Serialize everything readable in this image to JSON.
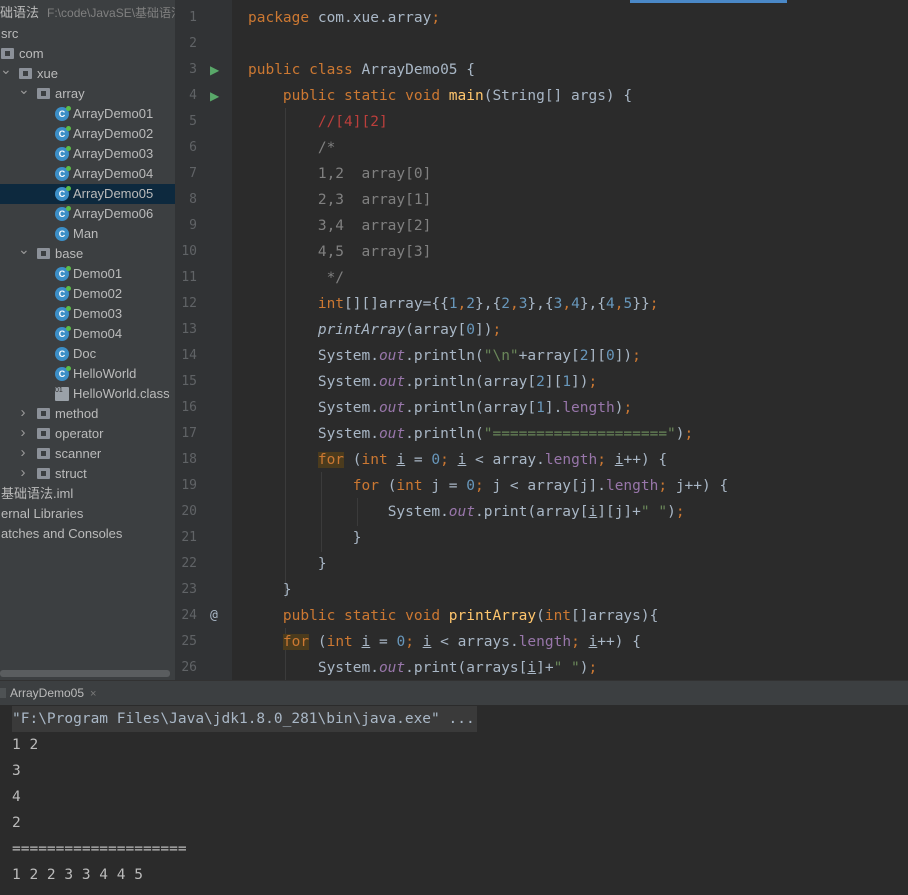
{
  "project": {
    "title": "础语法",
    "path": "F:\\code\\JavaSE\\基础语法"
  },
  "tree": [
    {
      "label": "src",
      "type": "none"
    },
    {
      "label": "com",
      "type": "folder"
    },
    {
      "label": "xue",
      "type": "folder"
    },
    {
      "label": "array",
      "type": "folder"
    },
    {
      "label": "ArrayDemo01",
      "type": "class"
    },
    {
      "label": "ArrayDemo02",
      "type": "class"
    },
    {
      "label": "ArrayDemo03",
      "type": "class"
    },
    {
      "label": "ArrayDemo04",
      "type": "class"
    },
    {
      "label": "ArrayDemo05",
      "type": "class",
      "selected": true
    },
    {
      "label": "ArrayDemo06",
      "type": "class"
    },
    {
      "label": "Man",
      "type": "class-nomain"
    },
    {
      "label": "base",
      "type": "folder"
    },
    {
      "label": "Demo01",
      "type": "class"
    },
    {
      "label": "Demo02",
      "type": "class"
    },
    {
      "label": "Demo03",
      "type": "class"
    },
    {
      "label": "Demo04",
      "type": "class"
    },
    {
      "label": "Doc",
      "type": "class-nomain"
    },
    {
      "label": "HelloWorld",
      "type": "class"
    },
    {
      "label": "HelloWorld.class",
      "type": "binary"
    },
    {
      "label": "method",
      "type": "folder"
    },
    {
      "label": "operator",
      "type": "folder"
    },
    {
      "label": "scanner",
      "type": "folder"
    },
    {
      "label": "struct",
      "type": "folder"
    },
    {
      "label": "基础语法.iml",
      "type": "none"
    },
    {
      "label": "ernal Libraries",
      "type": "none"
    },
    {
      "label": "atches and Consoles",
      "type": "none"
    }
  ],
  "editor": {
    "line_numbers": [
      "1",
      "2",
      "3",
      "4",
      "5",
      "6",
      "7",
      "8",
      "9",
      "10",
      "11",
      "12",
      "13",
      "14",
      "15",
      "16",
      "17",
      "18",
      "19",
      "20",
      "21",
      "22",
      "23",
      "24",
      "25",
      "26"
    ],
    "gutter_markers": {
      "run": "▶",
      "override": "@"
    },
    "lines": [
      [
        [
          "kw",
          "package "
        ],
        [
          "",
          "com.xue.array"
        ],
        [
          "kw",
          ";"
        ]
      ],
      [],
      [
        [
          "kw",
          "public class "
        ],
        [
          "",
          "ArrayDemo05 {"
        ]
      ],
      [
        [
          "",
          "    "
        ],
        [
          "kw",
          "public static void "
        ],
        [
          "fn",
          "main"
        ],
        [
          "",
          "(String[] args) {"
        ]
      ],
      [
        [
          "",
          "        "
        ],
        [
          "cmt-red",
          "//[4][2]"
        ]
      ],
      [
        [
          "",
          "        "
        ],
        [
          "cmt",
          "/*"
        ]
      ],
      [
        [
          "",
          "        "
        ],
        [
          "cmt",
          "1,2  array[0]"
        ]
      ],
      [
        [
          "",
          "        "
        ],
        [
          "cmt",
          "2,3  array[1]"
        ]
      ],
      [
        [
          "",
          "        "
        ],
        [
          "cmt",
          "3,4  array[2]"
        ]
      ],
      [
        [
          "",
          "        "
        ],
        [
          "cmt",
          "4,5  array[3]"
        ]
      ],
      [
        [
          "",
          "        "
        ],
        [
          "cmt",
          " */"
        ]
      ],
      [
        [
          "",
          "        "
        ],
        [
          "kw",
          "int"
        ],
        [
          "",
          "[][]array={{"
        ],
        [
          "num",
          "1"
        ],
        [
          "kw",
          ","
        ],
        [
          "num",
          "2"
        ],
        [
          "",
          "},{"
        ],
        [
          "num",
          "2"
        ],
        [
          "kw",
          ","
        ],
        [
          "num",
          "3"
        ],
        [
          "",
          "},{"
        ],
        [
          "num",
          "3"
        ],
        [
          "kw",
          ","
        ],
        [
          "num",
          "4"
        ],
        [
          "",
          "},{"
        ],
        [
          "num",
          "4"
        ],
        [
          "kw",
          ","
        ],
        [
          "num",
          "5"
        ],
        [
          "",
          "}}"
        ],
        [
          "kw",
          ";"
        ]
      ],
      [
        [
          "",
          "        "
        ],
        [
          "sfn",
          "printArray"
        ],
        [
          "",
          "(array["
        ],
        [
          "num",
          "0"
        ],
        [
          "",
          "])"
        ],
        [
          "kw",
          ";"
        ]
      ],
      [
        [
          "",
          "        "
        ],
        [
          "",
          "System."
        ],
        [
          "fld",
          "out"
        ],
        [
          "",
          ".println("
        ],
        [
          "str",
          "\"\\n\""
        ],
        [
          "",
          "+array["
        ],
        [
          "num",
          "2"
        ],
        [
          "",
          "]["
        ],
        [
          "num",
          "0"
        ],
        [
          "",
          "])"
        ],
        [
          "kw",
          ";"
        ]
      ],
      [
        [
          "",
          "        "
        ],
        [
          "",
          "System."
        ],
        [
          "fld",
          "out"
        ],
        [
          "",
          ".println(array["
        ],
        [
          "num",
          "2"
        ],
        [
          "",
          "]["
        ],
        [
          "num",
          "1"
        ],
        [
          "",
          "])"
        ],
        [
          "kw",
          ";"
        ]
      ],
      [
        [
          "",
          "        "
        ],
        [
          "",
          "System."
        ],
        [
          "fld",
          "out"
        ],
        [
          "",
          ".println(array["
        ],
        [
          "num",
          "1"
        ],
        [
          "",
          "]."
        ],
        [
          "fld2",
          "length"
        ],
        [
          "",
          ")"
        ],
        [
          "kw",
          ";"
        ]
      ],
      [
        [
          "",
          "        "
        ],
        [
          "",
          "System."
        ],
        [
          "fld",
          "out"
        ],
        [
          "",
          ".println("
        ],
        [
          "str",
          "\"====================\""
        ],
        [
          "",
          ")"
        ],
        [
          "kw",
          ";"
        ]
      ],
      [
        [
          "",
          "        "
        ],
        [
          "kw hl",
          "for"
        ],
        [
          "",
          " ("
        ],
        [
          "kw",
          "int "
        ],
        [
          "ul",
          "i"
        ],
        [
          "",
          " = "
        ],
        [
          "num",
          "0"
        ],
        [
          "kw",
          "; "
        ],
        [
          "ul",
          "i"
        ],
        [
          "",
          " < array."
        ],
        [
          "fld2",
          "length"
        ],
        [
          "kw",
          "; "
        ],
        [
          "ul",
          "i"
        ],
        [
          "",
          "++) {"
        ]
      ],
      [
        [
          "",
          "            "
        ],
        [
          "kw",
          "for "
        ],
        [
          "",
          "("
        ],
        [
          "kw",
          "int "
        ],
        [
          "",
          "j = "
        ],
        [
          "num",
          "0"
        ],
        [
          "kw",
          "; "
        ],
        [
          "",
          "j < array[j]."
        ],
        [
          "fld2",
          "length"
        ],
        [
          "kw",
          "; "
        ],
        [
          "",
          "j++) {"
        ]
      ],
      [
        [
          "",
          "                "
        ],
        [
          "",
          "System."
        ],
        [
          "fld",
          "out"
        ],
        [
          "",
          ".print(array["
        ],
        [
          "ul",
          "i"
        ],
        [
          "",
          "][j]+"
        ],
        [
          "str",
          "\" \""
        ],
        [
          "",
          ")"
        ],
        [
          "kw",
          ";"
        ]
      ],
      [
        [
          "",
          "            "
        ],
        [
          "",
          "}"
        ]
      ],
      [
        [
          "",
          "        "
        ],
        [
          "",
          "}"
        ]
      ],
      [
        [
          "",
          "    "
        ],
        [
          "",
          "}"
        ]
      ],
      [
        [
          "",
          "    "
        ],
        [
          "kw",
          "public static void "
        ],
        [
          "fn",
          "printArray"
        ],
        [
          "",
          "("
        ],
        [
          "kw",
          "int"
        ],
        [
          "",
          "[]arrays){"
        ]
      ],
      [
        [
          "",
          "    "
        ],
        [
          "kw hl",
          "for"
        ],
        [
          "",
          " ("
        ],
        [
          "kw",
          "int "
        ],
        [
          "ul",
          "i"
        ],
        [
          "",
          " = "
        ],
        [
          "num",
          "0"
        ],
        [
          "kw",
          "; "
        ],
        [
          "ul",
          "i"
        ],
        [
          "",
          " < arrays."
        ],
        [
          "fld2",
          "length"
        ],
        [
          "kw",
          "; "
        ],
        [
          "ul",
          "i"
        ],
        [
          "",
          "++) {"
        ]
      ],
      [
        [
          "",
          "        "
        ],
        [
          "",
          "System."
        ],
        [
          "fld",
          "out"
        ],
        [
          "",
          ".print(arrays["
        ],
        [
          "ul",
          "i"
        ],
        [
          "",
          "]+"
        ],
        [
          "str",
          "\" \""
        ],
        [
          "",
          ")"
        ],
        [
          "kw",
          ";"
        ]
      ]
    ]
  },
  "run": {
    "tab_label": "ArrayDemo05",
    "close_glyph": "×",
    "command": "\"F:\\Program Files\\Java\\jdk1.8.0_281\\bin\\java.exe\" ...",
    "output": [
      "1 2",
      "3",
      "4",
      "2",
      "====================",
      "1 2 2 3 3 4 4 5"
    ]
  },
  "colors": {
    "keyword": "#cc7832",
    "string": "#6a8759",
    "number": "#6897bb",
    "comment": "#808080",
    "selection": "#0d293e",
    "run_icon": "#59a869"
  }
}
